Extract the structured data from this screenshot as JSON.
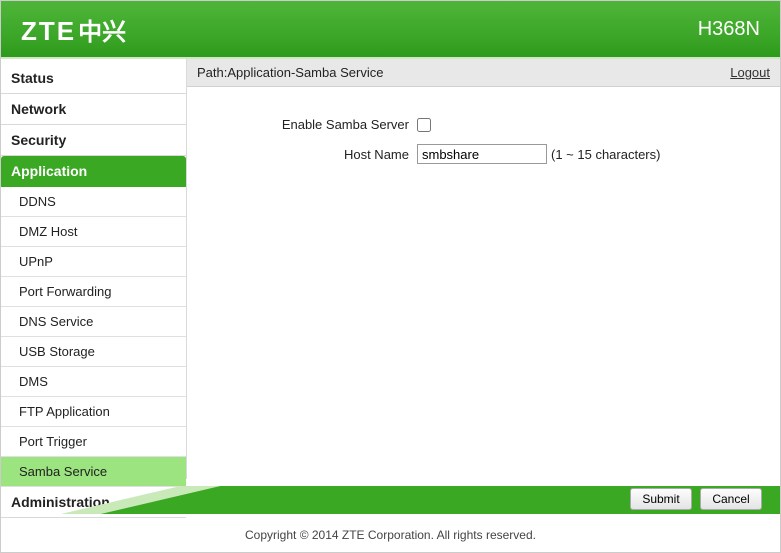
{
  "header": {
    "logo_en": "ZTE",
    "logo_cn": "中兴",
    "model": "H368N"
  },
  "breadcrumb": {
    "path_label": "Path:",
    "path_value": "Application-Samba Service",
    "logout": "Logout"
  },
  "sidebar": {
    "top": [
      {
        "label": "Status",
        "active": false
      },
      {
        "label": "Network",
        "active": false
      },
      {
        "label": "Security",
        "active": false
      },
      {
        "label": "Application",
        "active": true
      },
      {
        "label": "Administration",
        "active": false
      }
    ],
    "sub": [
      {
        "label": "DDNS",
        "active": false
      },
      {
        "label": "DMZ Host",
        "active": false
      },
      {
        "label": "UPnP",
        "active": false
      },
      {
        "label": "Port Forwarding",
        "active": false
      },
      {
        "label": "DNS Service",
        "active": false
      },
      {
        "label": "USB Storage",
        "active": false
      },
      {
        "label": "DMS",
        "active": false
      },
      {
        "label": "FTP Application",
        "active": false
      },
      {
        "label": "Port Trigger",
        "active": false
      },
      {
        "label": "Samba Service",
        "active": true
      }
    ]
  },
  "form": {
    "enable_label": "Enable Samba Server",
    "enable_checked": false,
    "hostname_label": "Host Name",
    "hostname_value": "smbshare",
    "hostname_hint": "(1 ~ 15 characters)"
  },
  "buttons": {
    "submit": "Submit",
    "cancel": "Cancel"
  },
  "footer": {
    "copyright": "Copyright © 2014 ZTE Corporation. All rights reserved."
  },
  "colors": {
    "brand_green": "#3aa823",
    "sub_active": "#9be47f"
  }
}
